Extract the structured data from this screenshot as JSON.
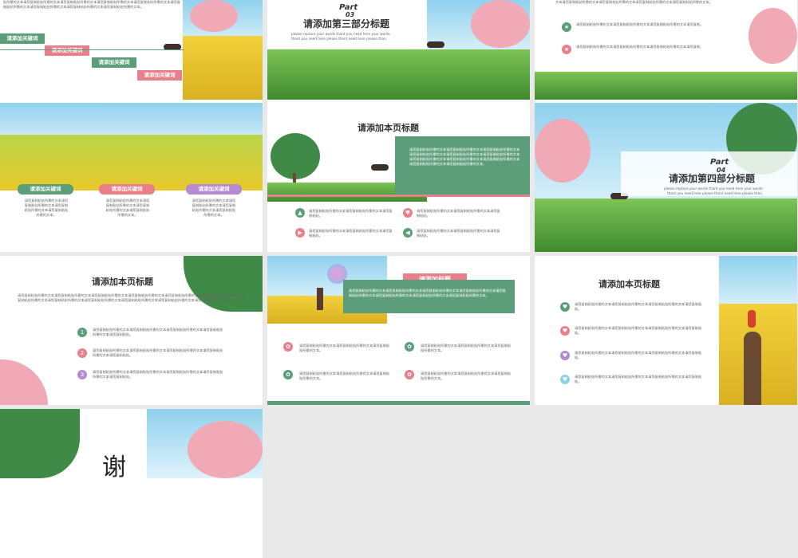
{
  "slide1": {
    "paragraph": "贴所需的文本请您复制粘贴所需的文本请您复制粘贴所需的文本请您复制粘贴所需的文本请您复制粘贴所需的文本请您复制粘贴所需的文本请您复制粘贴所需的文本请您复制粘贴所需的文本请您复制粘贴所需的文本。",
    "tags": [
      "请添加关键词",
      "请添加关键词",
      "请添加关键词",
      "请添加关键词"
    ]
  },
  "slide2": {
    "part": "Part",
    "number": "03",
    "title": "请添加第三部分标题",
    "subtitle1": "please replace your words thant you need here your words",
    "subtitle2": "thant you need here please thant need here please than."
  },
  "slide3": {
    "top_text": "文本请您复制粘贴所需的文本请您复制粘贴所需的文本请您复制粘贴所需的文本请您复制粘贴所需的文本。",
    "item1": "请您复制粘贴所需的文本请您复制粘贴所需的文本请您复制粘贴所需的文本请您复制。",
    "item2": "请您复制粘贴所需的文本请您复制粘贴所需的文本请您复制粘贴所需的文本请您复制。"
  },
  "slide4": {
    "tags": [
      "请添加关键词",
      "请添加关键词",
      "请添加关键词"
    ],
    "texts": [
      "请您复制粘贴所需的文本请您复制粘贴所需的文本请您复制粘贴所需的文本请您复制粘贴所需的文本。",
      "请您复制粘贴所需的文本请您复制粘贴所需的文本请您复制粘贴所需的文本请您复制粘贴所需的文本。",
      "请您复制粘贴所需的文本请您复制粘贴所需的文本请您复制粘贴所需的文本请您复制粘贴所需的文本。"
    ]
  },
  "slide5": {
    "title": "请添加本页标题",
    "box_text": "请您复制粘贴所需的文本请您复制粘贴所需的文本请您复制粘贴所需的文本请您复制粘贴所需的文本请您复制粘贴所需的文本请您复制粘贴所需的文本请您复制粘贴所需的文本请您复制粘贴所需的文本请您复制粘贴所需的文本请您复制粘贴所需的文本请您复制粘贴所需的文本。",
    "items": [
      "请您复制粘贴所需的文本请您复制粘贴所需的文本请您复制粘贴。",
      "请您复制粘贴所需的文本请您复制粘贴所需的文本请您复制粘贴。",
      "请您复制粘贴所需的文本请您复制粘贴所需的文本请您复制粘贴。",
      "请您复制粘贴所需的文本请您复制粘贴所需的文本请您复制粘贴。"
    ]
  },
  "slide6": {
    "part": "Part",
    "number": "04",
    "title": "请添加第四部分标题",
    "subtitle1": "please replace your words thant you need here your words",
    "subtitle2": "thant you need here please thant need here please than."
  },
  "slide7": {
    "title": "请添加本页标题",
    "paragraph": "请您复制粘贴所需的文本请您复制粘贴所需的文本请您复制粘贴所需的文本请您复制粘贴所需的文本请您复制粘贴所需的文本请您复制粘贴所需的文本请您复制粘贴所需的文本请您复制粘贴所需的文本请您复制粘贴所需的文本请您复制粘贴所需的文本请您复制粘贴所需的文本请您复制粘贴所需的文本。",
    "numbers": [
      "1",
      "2",
      "3"
    ],
    "items": [
      "请您复制粘贴所需的文本请您复制粘贴所需的文本请您复制粘贴所需的文本请您复制粘贴所需的文本请您复制粘贴。",
      "请您复制粘贴所需的文本请您复制粘贴所需的文本请您复制粘贴所需的文本请您复制粘贴所需的文本请您复制粘贴。",
      "请您复制粘贴所需的文本请您复制粘贴所需的文本请您复制粘贴所需的文本请您复制粘贴所需的文本请您复制粘贴。"
    ]
  },
  "slide8": {
    "title": "请添加标题",
    "box_text": "请您复制粘贴所需的文本请您复制粘贴所需的文本请您复制粘贴所需的文本请您复制粘贴所需的文本请您复制粘贴所需的文本请您复制粘贴所需的文本请您复制粘贴所需的文本请您复制粘贴所需的文本。",
    "items": [
      "请您复制粘贴所需的文本请您复制粘贴所需的文本请您复制粘贴所需的文本。",
      "请您复制粘贴所需的文本请您复制粘贴所需的文本请您复制粘贴所需的文本。",
      "请您复制粘贴所需的文本请您复制粘贴所需的文本请您复制粘贴所需的文本。",
      "请您复制粘贴所需的文本请您复制粘贴所需的文本请您复制粘贴所需的文本。"
    ]
  },
  "slide9": {
    "title": "请添加本页标题",
    "items": [
      "请您复制粘贴所需的文本请您复制粘贴所需的文本请您复制粘贴所需的文本请您复制粘贴。",
      "请您复制粘贴所需的文本请您复制粘贴所需的文本请您复制粘贴所需的文本请您复制粘贴。",
      "请您复制粘贴所需的文本请您复制粘贴所需的文本请您复制粘贴所需的文本请您复制粘贴。",
      "请您复制粘贴所需的文本请您复制粘贴所需的文本请您复制粘贴所需的文本请您复制粘贴。"
    ]
  },
  "slide10": {
    "thanks": "谢"
  },
  "colors": {
    "green": "#5c9e79",
    "pink": "#e87f8b",
    "purple": "#b48bd1",
    "blue": "#8fd0ea"
  }
}
